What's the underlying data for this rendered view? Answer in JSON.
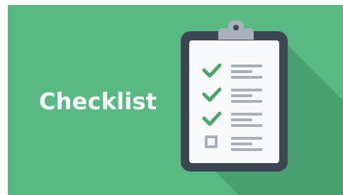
{
  "title": "Checklist",
  "colors": {
    "background": "#59b983",
    "shadow": "#48a070",
    "board": "#3c4652",
    "paper": "#f8f9fa",
    "clip": "#a7b0bb",
    "check": "#4ea46b",
    "line": "#a7b0bb",
    "box": "#a7b0bb",
    "text": "#ffffff"
  },
  "checklist": {
    "items": [
      {
        "state": "checked",
        "icon": "check-icon"
      },
      {
        "state": "checked",
        "icon": "check-icon"
      },
      {
        "state": "checked",
        "icon": "check-icon"
      },
      {
        "state": "unchecked",
        "icon": "empty-box-icon"
      }
    ]
  }
}
